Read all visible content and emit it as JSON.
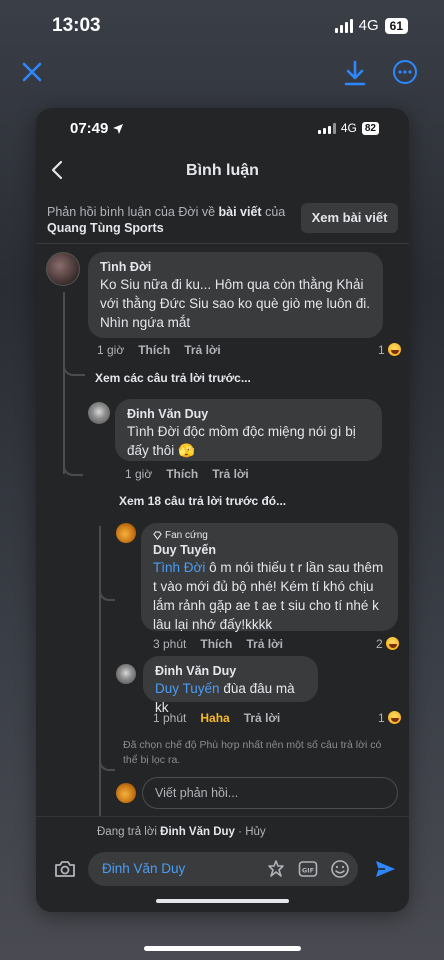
{
  "outer_status": {
    "time": "13:03",
    "network": "4G",
    "battery": "61"
  },
  "outer_toolbar": {
    "close_icon": "close-icon",
    "download_icon": "download-icon",
    "more_icon": "more-icon"
  },
  "inner_status": {
    "time": "07:49",
    "network": "4G",
    "battery": "82"
  },
  "header": {
    "title": "Bình luận"
  },
  "context": {
    "prefix": "Phản hồi bình luận của Đời về",
    "post_word": "bài viết",
    "of_word": "của",
    "page_name": "Quang Tùng Sports",
    "view_post_label": "Xem bài viết"
  },
  "comments": [
    {
      "author": "Tình Đời",
      "text": "Ko Siu nữa đi ku... Hôm qua còn thằng Khải với thằng Đức Siu sao ko què giò mẹ luôn đi. Nhìn ngứa mắt",
      "time": "1 giờ",
      "like": "Thích",
      "reply": "Trả lời",
      "reaction_count": "1"
    },
    {
      "author": "Đinh Văn Duy",
      "text": "Tình Đời độc mồm độc miệng nói gì bị đấy thôi",
      "emoji": "🫣",
      "time": "1 giờ",
      "like": "Thích",
      "reply": "Trả lời"
    },
    {
      "badge": "Fan cứng",
      "author": "Duy Tuyến",
      "mention": "Tình Đời",
      "text": "ô m nói thiếu t r lần sau thêm t vào mới đủ bộ nhé! Kém tí khó chịu lắm rảnh gặp ae t ae t siu cho tí nhé k lâu lại nhớ đấy!kkkk",
      "time": "3 phút",
      "like": "Thích",
      "reply": "Trả lời",
      "reaction_count": "2"
    },
    {
      "author": "Đinh Văn Duy",
      "mention": "Duy Tuyến",
      "text": "đùa đâu mà kk",
      "time": "1 phút",
      "like": "Haha",
      "reply": "Trả lời",
      "reaction_count": "1"
    }
  ],
  "see_previous_1": "Xem các câu trả lời trước...",
  "see_previous_2": "Xem 18 câu trả lời trước đó...",
  "filter_note": "Đã chọn chế độ Phù hợp nhất nên một số câu trả lời có thể bị lọc ra.",
  "reply_placeholder": "Viết phản hồi...",
  "compose": {
    "replying_prefix": "Đang trả lời",
    "replying_to": "Đinh Văn Duy",
    "separator": "·",
    "cancel": "Hủy",
    "value": "Đinh Văn Duy"
  },
  "colors": {
    "background": "#242526",
    "bubble": "#3a3b3c",
    "accent": "#4b9cf5",
    "haha": "#f7b928"
  }
}
